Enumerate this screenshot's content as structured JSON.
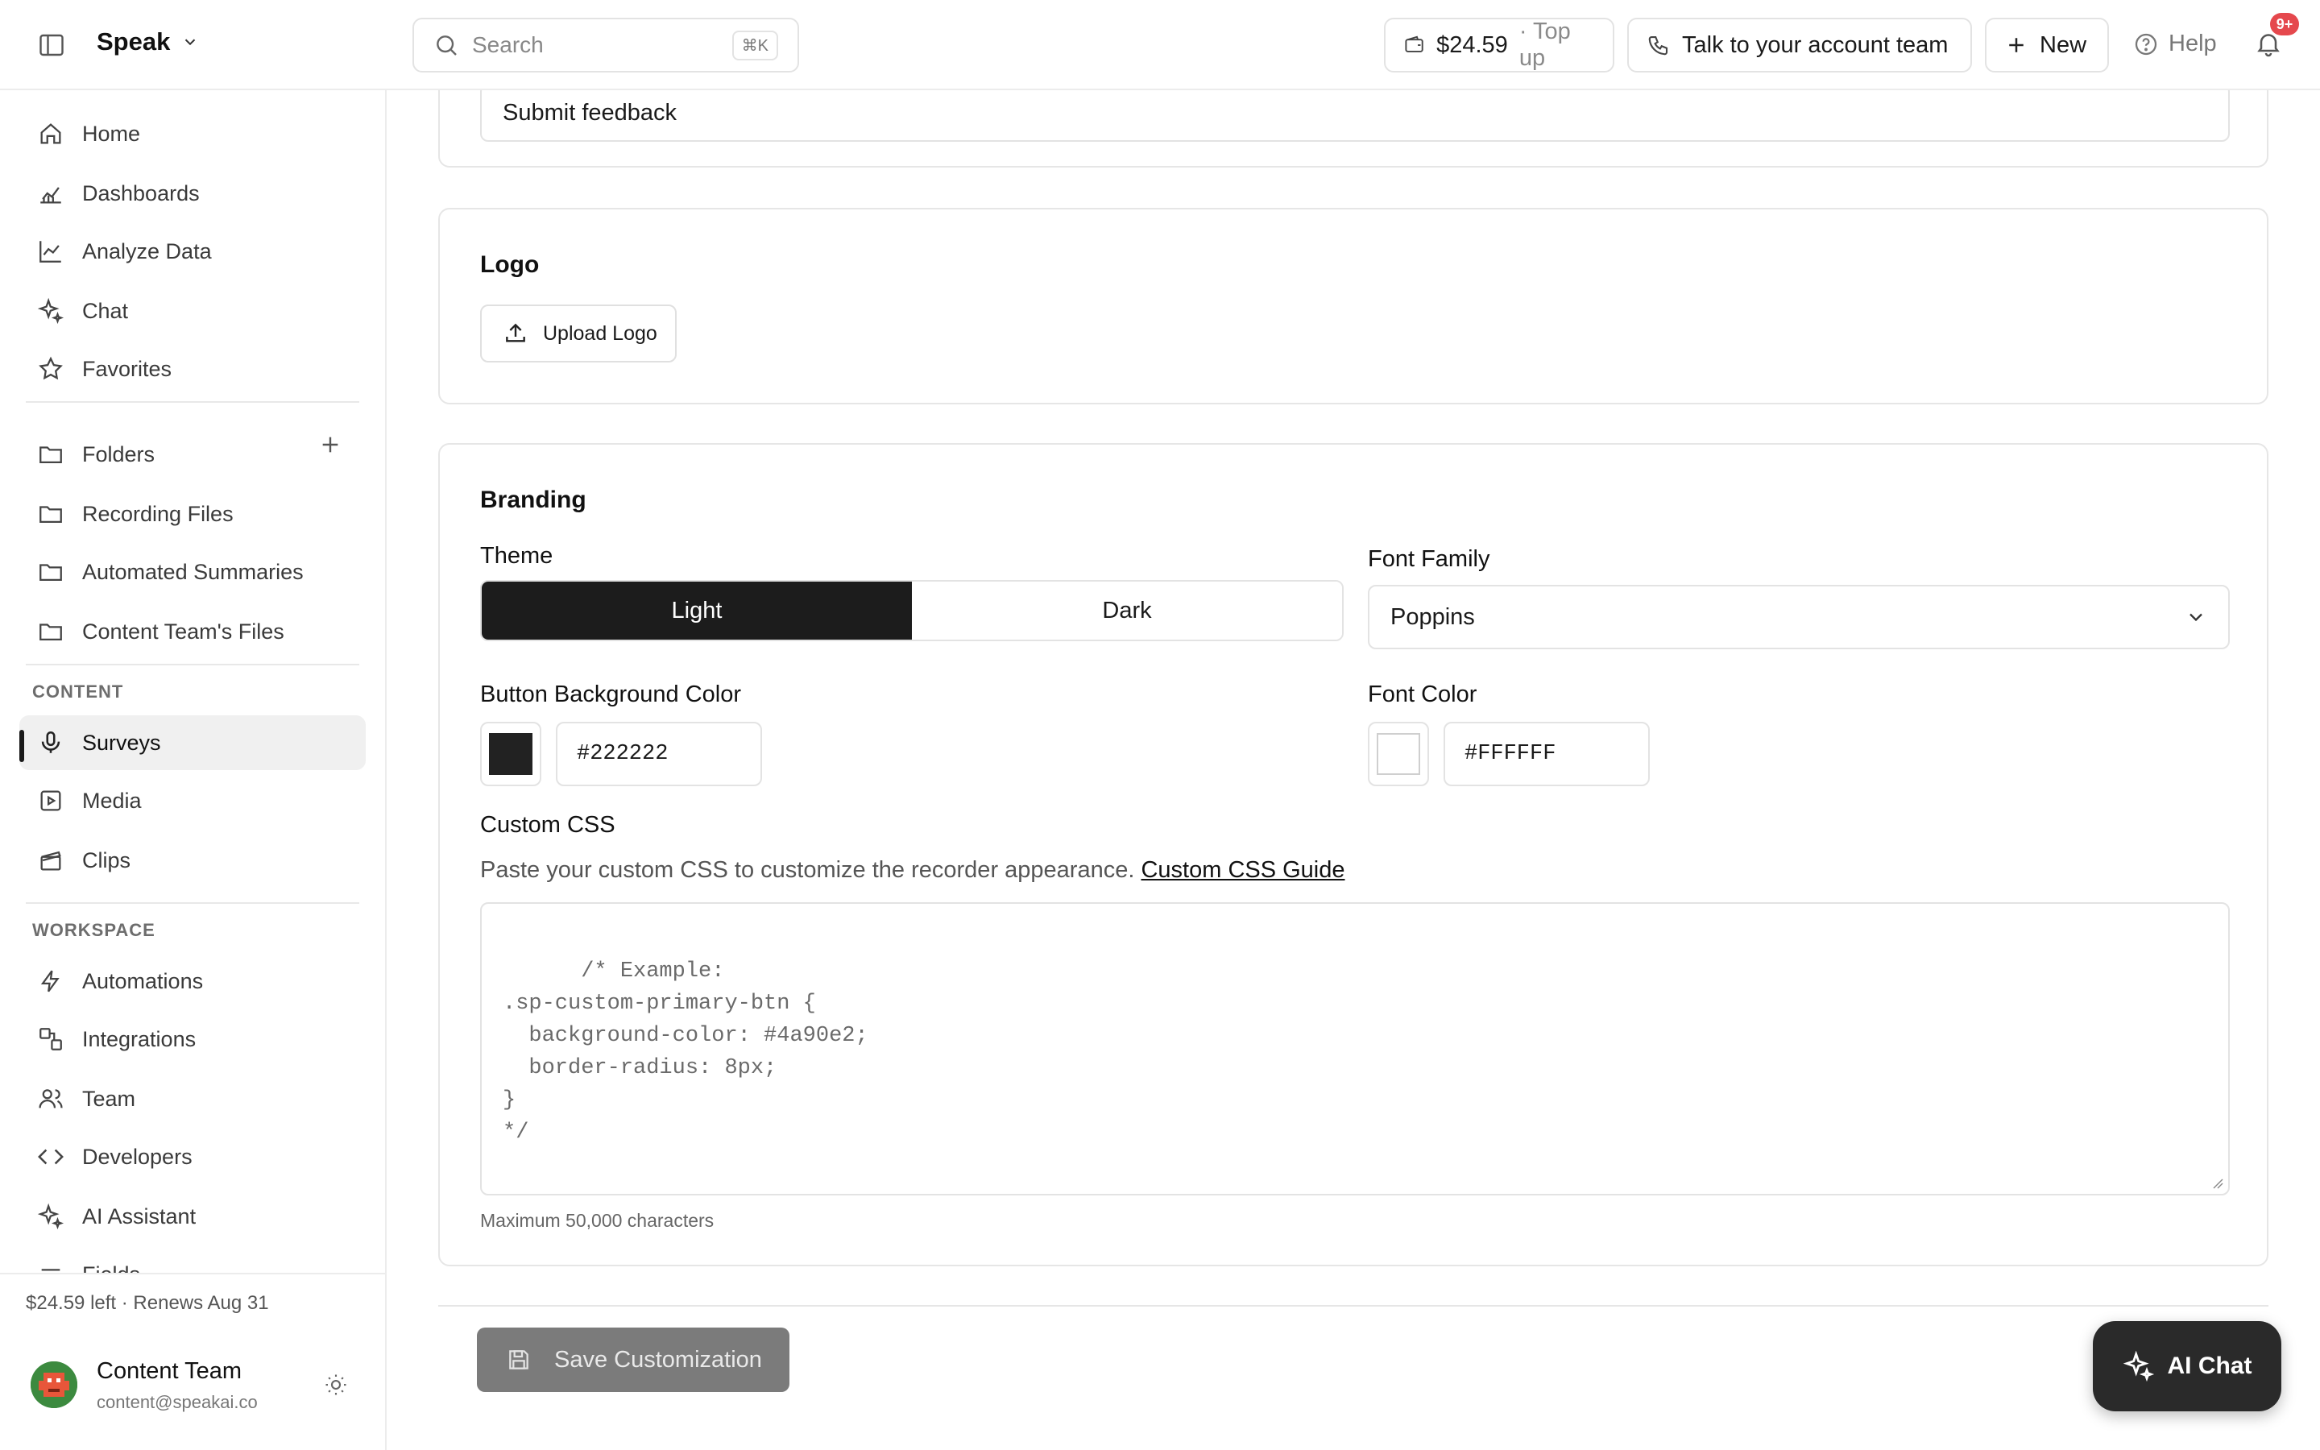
{
  "app": {
    "brand": "Speak"
  },
  "topbar": {
    "search_placeholder": "Search",
    "search_shortcut": "⌘K",
    "balance": "$24.59",
    "top_up": "· Top up",
    "account_team": "Talk to your account team",
    "new_label": "New",
    "help_label": "Help",
    "notifications_badge": "9+"
  },
  "sidebar": {
    "primary": [
      "Home",
      "Dashboards",
      "Analyze Data",
      "Chat",
      "Favorites"
    ],
    "folders_label": "Folders",
    "folders": [
      "Recording Files",
      "Automated Summaries",
      "Content Team's Files"
    ],
    "content_label": "CONTENT",
    "content": [
      "Surveys",
      "Media",
      "Clips"
    ],
    "active_item": "Surveys",
    "workspace_label": "WORKSPACE",
    "workspace": [
      "Automations",
      "Integrations",
      "Team",
      "Developers",
      "AI Assistant",
      "Fields"
    ],
    "footer": {
      "credit": "$24.59 left · Renews Aug 31",
      "user_name": "Content Team",
      "user_email": "content@speakai.co"
    }
  },
  "main": {
    "submit_field_value": "Submit feedback",
    "logo": {
      "title": "Logo",
      "upload_label": "Upload Logo"
    },
    "branding": {
      "title": "Branding",
      "theme_label": "Theme",
      "theme_options": [
        "Light",
        "Dark"
      ],
      "theme_selected": "Light",
      "font_family_label": "Font Family",
      "font_family_value": "Poppins",
      "button_bg_label": "Button Background Color",
      "button_bg_value": "#222222",
      "font_color_label": "Font Color",
      "font_color_value": "#FFFFFF",
      "custom_css_label": "Custom CSS",
      "custom_css_desc": "Paste your custom CSS to customize the recorder appearance.",
      "custom_css_link": "Custom CSS Guide",
      "custom_css_placeholder": "/* Example:\n.sp-custom-primary-btn {\n  background-color: #4a90e2;\n  border-radius: 8px;\n}\n*/",
      "custom_css_hint": "Maximum 50,000 characters"
    },
    "save_label": "Save Customization",
    "ai_chat_label": "AI Chat"
  },
  "colors": {
    "button_bg_swatch": "#222222",
    "font_color_swatch": "#FFFFFF",
    "accent_dark": "#1c1c1c",
    "badge": "#e5484d"
  }
}
